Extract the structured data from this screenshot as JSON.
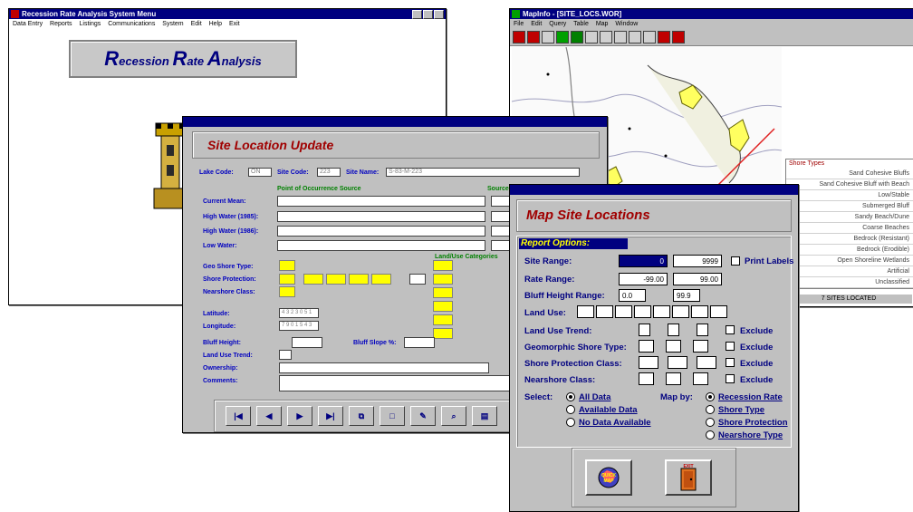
{
  "recession_window": {
    "title": "Recession Rate Analysis System Menu",
    "menu": [
      "Data Entry",
      "Reports",
      "Listings",
      "Communications",
      "System",
      "Edit",
      "Help",
      "Exit"
    ],
    "banner": {
      "r1": "R",
      "t1": "ecession ",
      "r2": "R",
      "t2": "ate ",
      "r3": "A",
      "t3": "nalysis"
    }
  },
  "map_window": {
    "title": "MapInfo - [SITE_LOCS.WOR]",
    "menu": [
      "File",
      "Edit",
      "Query",
      "Table",
      "Map",
      "Window"
    ],
    "legend_title": "Shore Types",
    "legend_items": [
      "Sand Cohesive Bluffs",
      "Sand Cohesive Bluff with Beach",
      "Low/Stable",
      "Submerged Bluff",
      "Sandy Beach/Dune",
      "Coarse Beaches",
      "Bedrock (Resistant)",
      "Bedrock (Erodible)",
      "Open Shoreline Wetlands",
      "Artificial",
      "Unclassified"
    ],
    "status": "7 SITES LOCATED"
  },
  "site_window": {
    "heading": "Site Location Update",
    "lake_code_label": "Lake Code:",
    "lake_code_value": "ON",
    "site_code_label": "Site Code:",
    "site_code_value": "223",
    "site_name_label": "Site Name:",
    "site_name_value": "S-83-M-223",
    "points_header": "Point of Occurrence Source",
    "source_header": "Source",
    "rows": [
      "Current Mean:",
      "High Water (1985):",
      "High Water (1986):",
      "Low Water:"
    ],
    "land_header": "Land/Use Categories",
    "class_rows": [
      "Geo Shore Type:",
      "Shore Protection:",
      "Nearshore Class:"
    ],
    "latitude_label": "Latitude:",
    "latitude_value": "4 3 2 3 0 5 1",
    "longitude_label": "Longitude:",
    "longitude_value": "7 9 0 1 5 4 3",
    "bluff_height_label": "Bluff Height:",
    "bluff_slope_label": "Bluff Slope %:",
    "land_use_trend_label": "Land Use Trend:",
    "ownership_label": "Ownership:",
    "comments_label": "Comments:"
  },
  "map_sites_window": {
    "heading": "Map Site Locations",
    "options_label": "Report Options:",
    "site_range_label": "Site Range:",
    "site_from": "0",
    "site_to": "9999",
    "print_labels": "Print Labels",
    "rate_range_label": "Rate Range:",
    "rate_from": "-99.00",
    "rate_to": "99.00",
    "bluff_range_label": "Bluff Height Range:",
    "bluff_from": "0.0",
    "bluff_to": "99.9",
    "land_use_label": "Land Use:",
    "trend_label": "Land Use Trend:",
    "geo_label": "Geomorphic Shore Type:",
    "protection_label": "Shore Protection Class:",
    "nearshore_label": "Nearshore Class:",
    "exclude": "Exclude",
    "select_label": "Select:",
    "select_opts": [
      "All Data",
      "Available Data",
      "No Data Available"
    ],
    "mapby_label": "Map by:",
    "mapby_opts": [
      "Recession Rate",
      "Shore Type",
      "Shore Protection",
      "Nearshore Type"
    ],
    "quick_map_icon": "QUICK MAP",
    "exit_icon": "EXIT"
  },
  "colors": {
    "title_bar": "#000080",
    "label_blue": "#0000c0",
    "heading_red": "#a00000",
    "field_yellow": "#ffff00",
    "label_green": "#008000"
  }
}
